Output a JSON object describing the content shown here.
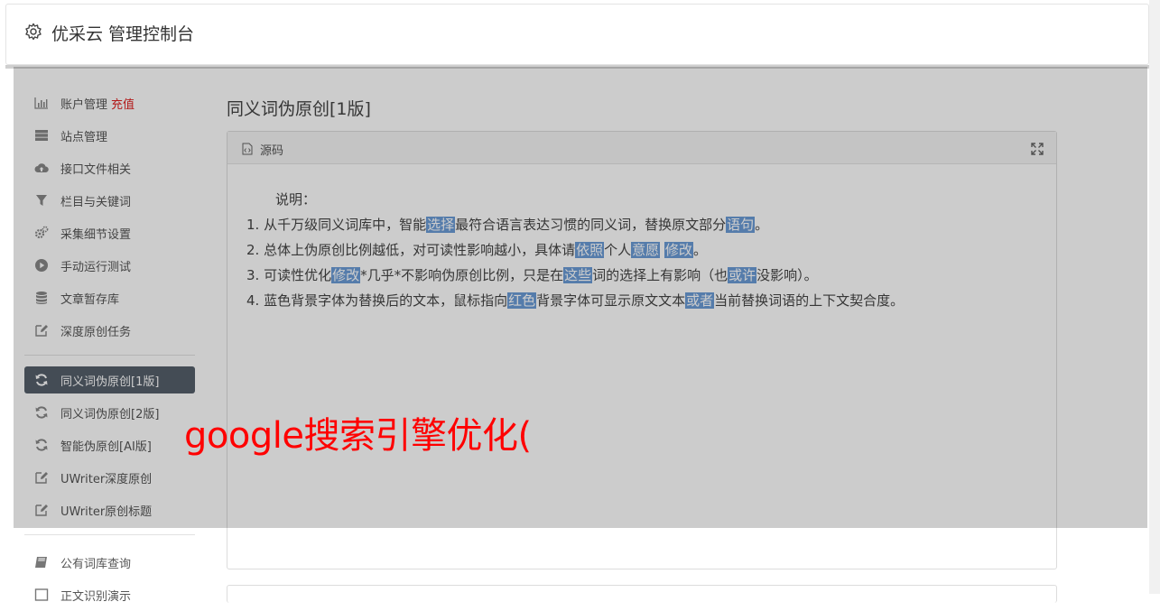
{
  "header": {
    "title": "优采云 管理控制台"
  },
  "sidebar": {
    "group1": [
      {
        "label": "账户管理",
        "badge": "充值",
        "icon": "bar-chart-icon"
      },
      {
        "label": "站点管理",
        "icon": "server-icon"
      },
      {
        "label": "接口文件相关",
        "icon": "cloud-upload-icon"
      },
      {
        "label": "栏目与关键词",
        "icon": "filter-icon"
      },
      {
        "label": "采集细节设置",
        "icon": "gears-icon"
      },
      {
        "label": "手动运行测试",
        "icon": "play-circle-icon"
      },
      {
        "label": "文章暂存库",
        "icon": "database-icon"
      },
      {
        "label": "深度原创任务",
        "icon": "edit-icon"
      }
    ],
    "group2": [
      {
        "label": "同义词伪原创[1版]",
        "icon": "refresh-icon"
      },
      {
        "label": "同义词伪原创[2版]",
        "icon": "refresh-icon"
      },
      {
        "label": "智能伪原创[AI版]",
        "icon": "refresh-icon"
      },
      {
        "label": "UWriter深度原创",
        "icon": "edit-icon"
      },
      {
        "label": "UWriter原创标题",
        "icon": "edit-icon"
      }
    ],
    "group3": [
      {
        "label": "公有词库查询",
        "icon": "book-icon"
      },
      {
        "label": "正文识别演示",
        "icon": "square-icon"
      }
    ]
  },
  "main": {
    "page_title": "同义词伪原创[1版]",
    "panel": {
      "header_label": "源码",
      "intro": "说明：",
      "lines": [
        [
          "1. 从千万级同义词库中，智能",
          {
            "hl": "选择"
          },
          "最符合语言表达习惯的同义词，替换原文部分",
          {
            "hl": "语句"
          },
          "。"
        ],
        [
          "2. 总体上伪原创比例越低，对可读性影响越小，具体请",
          {
            "hl": "依照"
          },
          "个人",
          {
            "hl": "意愿"
          },
          " ",
          {
            "hl": "修改"
          },
          "。"
        ],
        [
          "3. 可读性优化",
          {
            "hl": "修改"
          },
          "*几乎*不影响伪原创比例，只是在",
          {
            "hl": "这些"
          },
          "词的选择上有影响（也",
          {
            "hl": "或许"
          },
          "没影响）。"
        ],
        [
          "4. 蓝色背景字体为替换后的文本，鼠标指向",
          {
            "hl": "红色"
          },
          "背景字体可显示原文文本",
          {
            "hl": "或者"
          },
          "当前替换词语的上下文契合度。"
        ]
      ]
    }
  },
  "watermark": "google搜索引擎优化(",
  "colors": {
    "active_bg": "#555f6b",
    "highlight": "#6b9cd6",
    "recharge": "#e02020",
    "watermark": "#ff0000"
  }
}
